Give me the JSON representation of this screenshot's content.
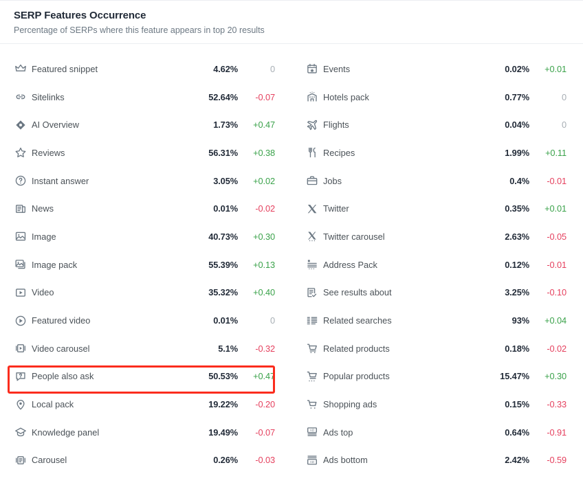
{
  "header": {
    "title": "SERP Features Occurrence",
    "subtitle": "Percentage of SERPs where this feature appears in top 20 results"
  },
  "colors": {
    "positive": "#3aa24a",
    "negative": "#e5405e",
    "neutral": "#a7aeb4",
    "highlight": "#fb2c1d",
    "title": "#222b38",
    "subtitle": "#6c7883"
  },
  "highlight": {
    "target_feature": "People also ask"
  },
  "left_column": [
    {
      "icon": "crown-icon",
      "label": "Featured snippet",
      "value": "4.62%",
      "change": "0",
      "trend": "flat"
    },
    {
      "icon": "link-icon",
      "label": "Sitelinks",
      "value": "52.64%",
      "change": "-0.07",
      "trend": "down"
    },
    {
      "icon": "ai-diamond-icon",
      "label": "AI Overview",
      "value": "1.73%",
      "change": "+0.47",
      "trend": "up"
    },
    {
      "icon": "star-icon",
      "label": "Reviews",
      "value": "56.31%",
      "change": "+0.38",
      "trend": "up"
    },
    {
      "icon": "question-circle-icon",
      "label": "Instant answer",
      "value": "3.05%",
      "change": "+0.02",
      "trend": "up"
    },
    {
      "icon": "news-icon",
      "label": "News",
      "value": "0.01%",
      "change": "-0.02",
      "trend": "down"
    },
    {
      "icon": "image-icon",
      "label": "Image",
      "value": "40.73%",
      "change": "+0.30",
      "trend": "up"
    },
    {
      "icon": "image-pack-icon",
      "label": "Image pack",
      "value": "55.39%",
      "change": "+0.13",
      "trend": "up"
    },
    {
      "icon": "video-icon",
      "label": "Video",
      "value": "35.32%",
      "change": "+0.40",
      "trend": "up"
    },
    {
      "icon": "featured-video-icon",
      "label": "Featured video",
      "value": "0.01%",
      "change": "0",
      "trend": "flat"
    },
    {
      "icon": "video-carousel-icon",
      "label": "Video carousel",
      "value": "5.1%",
      "change": "-0.32",
      "trend": "down"
    },
    {
      "icon": "people-also-ask-icon",
      "label": "People also ask",
      "value": "50.53%",
      "change": "+0.47",
      "trend": "up"
    },
    {
      "icon": "map-pin-icon",
      "label": "Local pack",
      "value": "19.22%",
      "change": "-0.20",
      "trend": "down"
    },
    {
      "icon": "graduation-cap-icon",
      "label": "Knowledge panel",
      "value": "19.49%",
      "change": "-0.07",
      "trend": "down"
    },
    {
      "icon": "carousel-icon",
      "label": "Carousel",
      "value": "0.26%",
      "change": "-0.03",
      "trend": "down"
    }
  ],
  "right_column": [
    {
      "icon": "calendar-star-icon",
      "label": "Events",
      "value": "0.02%",
      "change": "+0.01",
      "trend": "up"
    },
    {
      "icon": "hotel-icon",
      "label": "Hotels pack",
      "value": "0.77%",
      "change": "0",
      "trend": "flat"
    },
    {
      "icon": "airplane-icon",
      "label": "Flights",
      "value": "0.04%",
      "change": "0",
      "trend": "flat"
    },
    {
      "icon": "cutlery-icon",
      "label": "Recipes",
      "value": "1.99%",
      "change": "+0.11",
      "trend": "up"
    },
    {
      "icon": "briefcase-icon",
      "label": "Jobs",
      "value": "0.4%",
      "change": "-0.01",
      "trend": "down"
    },
    {
      "icon": "twitter-x-icon",
      "label": "Twitter",
      "value": "0.35%",
      "change": "+0.01",
      "trend": "up"
    },
    {
      "icon": "twitter-carousel-icon",
      "label": "Twitter carousel",
      "value": "2.63%",
      "change": "-0.05",
      "trend": "down"
    },
    {
      "icon": "address-pack-icon",
      "label": "Address Pack",
      "value": "0.12%",
      "change": "-0.01",
      "trend": "down"
    },
    {
      "icon": "see-results-icon",
      "label": "See results about",
      "value": "3.25%",
      "change": "-0.10",
      "trend": "down"
    },
    {
      "icon": "related-searches-icon",
      "label": "Related searches",
      "value": "93%",
      "change": "+0.04",
      "trend": "up"
    },
    {
      "icon": "related-products-icon",
      "label": "Related products",
      "value": "0.18%",
      "change": "-0.02",
      "trend": "down"
    },
    {
      "icon": "popular-products-icon",
      "label": "Popular products",
      "value": "15.47%",
      "change": "+0.30",
      "trend": "up"
    },
    {
      "icon": "shopping-ads-icon",
      "label": "Shopping ads",
      "value": "0.15%",
      "change": "-0.33",
      "trend": "down"
    },
    {
      "icon": "ads-top-icon",
      "label": "Ads top",
      "value": "0.64%",
      "change": "-0.91",
      "trend": "down"
    },
    {
      "icon": "ads-bottom-icon",
      "label": "Ads bottom",
      "value": "2.42%",
      "change": "-0.59",
      "trend": "down"
    }
  ]
}
